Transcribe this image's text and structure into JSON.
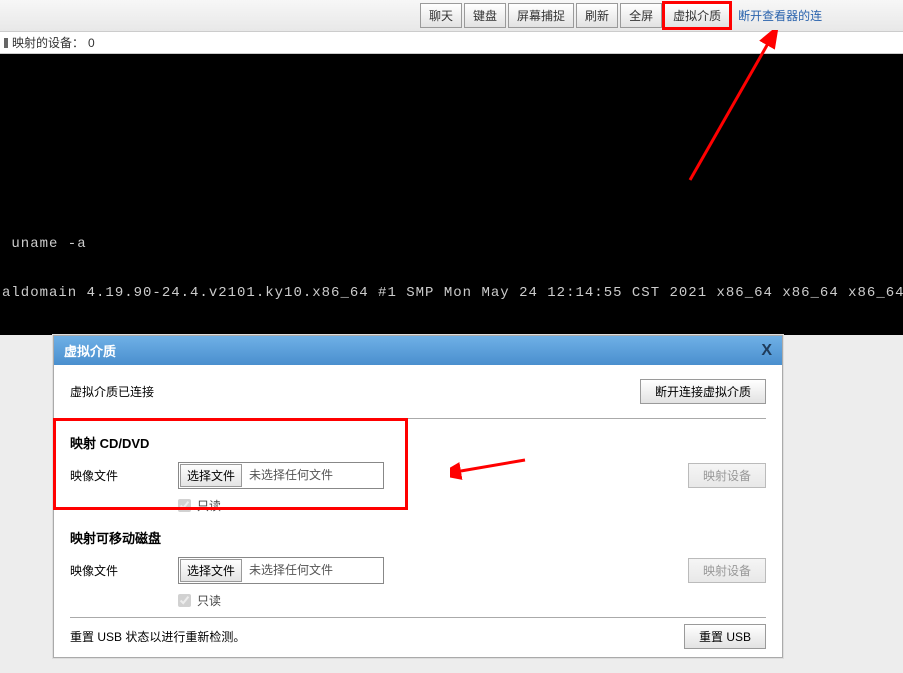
{
  "toolbar": {
    "chat": "聊天",
    "keyboard": "键盘",
    "screencap": "屏幕捕捉",
    "refresh": "刷新",
    "fullscreen": "全屏",
    "virtualmedia": "虚拟介质",
    "disconnect_link": "断开查看器的连"
  },
  "status": {
    "mapped_devices_label": "映射的设备：",
    "mapped_devices_count": "0"
  },
  "terminal": {
    "line1": " uname -a",
    "line2": "aldomain 4.19.90-24.4.v2101.ky10.x86_64 #1 SMP Mon May 24 12:14:55 CST 2021 x86_64 x86_64 x86_64"
  },
  "dialog": {
    "title": "虚拟介质",
    "close": "X",
    "connected_text": "虚拟介质已连接",
    "disconnect_btn": "断开连接虚拟介质",
    "cddvd_title": "映射 CD/DVD",
    "image_label": "映像文件",
    "choose_file_btn": "选择文件",
    "no_file_text": "未选择任何文件",
    "map_device_btn": "映射设备",
    "readonly_label": "只读",
    "removable_title": "映射可移动磁盘",
    "reset_text": "重置 USB 状态以进行重新检测。",
    "reset_btn": "重置 USB"
  }
}
